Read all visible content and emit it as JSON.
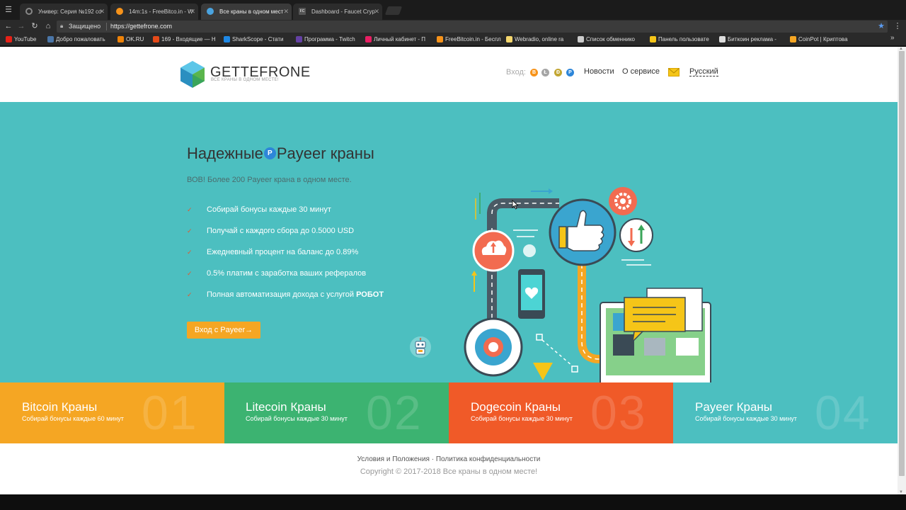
{
  "browser": {
    "tabs": [
      {
        "label": "Универ: Серия №192 со",
        "color": "#888888"
      },
      {
        "label": "14m:1s - FreeBitco.in - W",
        "color": "#f7931a"
      },
      {
        "label": "Все краны в одном мест",
        "color": "#4aa3df"
      },
      {
        "label": "Dashboard - Faucet Cryp",
        "color": "#666666",
        "prefix": "FC"
      }
    ],
    "secure_label": "Защищено",
    "url": "https://gettefrone.com",
    "bookmarks": [
      {
        "label": "YouTube",
        "color": "#e62117"
      },
      {
        "label": "Добро пожаловать",
        "color": "#4a76a8"
      },
      {
        "label": "OK.RU",
        "color": "#ee8208"
      },
      {
        "label": "169 - Входящие — Н",
        "color": "#e64a19"
      },
      {
        "label": "SharkScope - Стати",
        "color": "#1e88e5"
      },
      {
        "label": "Программа - Twitch",
        "color": "#6441a4"
      },
      {
        "label": "Личный кабинет - П",
        "color": "#e91e63"
      },
      {
        "label": "FreeBitcoin.in - Беспл",
        "color": "#f7931a"
      },
      {
        "label": "Webradio, online ra",
        "color": "#f5d76e"
      },
      {
        "label": "Список обменнико",
        "color": "#cccccc"
      },
      {
        "label": "Панель пользовате",
        "color": "#f5c518"
      },
      {
        "label": "Биткоин реклама -",
        "color": "#dddddd"
      },
      {
        "label": "CoinPot | Криптова",
        "color": "#f5a623"
      }
    ]
  },
  "header": {
    "logo_title": "GETTEFRONE",
    "logo_subtitle": "ВСЕ КРАНЫ В ОДНОМ МЕСТЕ!",
    "login_label": "Вход:",
    "coins": [
      {
        "symbol": "B",
        "color": "#f7931a"
      },
      {
        "symbol": "Ł",
        "color": "#a5a5a5"
      },
      {
        "symbol": "Ð",
        "color": "#c2a633"
      },
      {
        "symbol": "P",
        "color": "#2d86d9"
      }
    ],
    "nav": [
      "Новости",
      "О сервисе"
    ],
    "language": "Русский"
  },
  "hero": {
    "title_before": "Надежные",
    "title_badge": "P",
    "title_after": "Payeer краны",
    "subtitle": "ВОВ! Более 200 Payeer крана в одном месте.",
    "features": [
      {
        "text": "Собирай бонусы каждые 30 минут",
        "bold": ""
      },
      {
        "text": "Получай с каждого сбора до 0.5000 USD",
        "bold": ""
      },
      {
        "text": "Ежедневный процент на баланс до 0.89%",
        "bold": ""
      },
      {
        "text": "0.5% платим с заработка ваших рефералов",
        "bold": ""
      },
      {
        "text": "Полная автоматизация дохода с услугой ",
        "bold": "РОБОТ"
      }
    ],
    "cta_label": "Вход с Payeer→"
  },
  "tiles": [
    {
      "title": "Bitcoin Краны",
      "subtitle": "Собирай бонусы каждые 60 минут",
      "number": "01",
      "color": "#f5a623"
    },
    {
      "title": "Litecoin Краны",
      "subtitle": "Собирай бонусы каждые 30 минут",
      "number": "02",
      "color": "#3cb371"
    },
    {
      "title": "Dogecoin Краны",
      "subtitle": "Собирай бонусы каждые 30 минут",
      "number": "03",
      "color": "#f05a28"
    },
    {
      "title": "Payeer Краны",
      "subtitle": "Собирай бонусы каждые 30 минут",
      "number": "04",
      "color": "#4cbfc0"
    }
  ],
  "footer": {
    "links": [
      "Условия и Положения",
      "Политика конфиденциальности"
    ],
    "separator": "·",
    "copyright": "Copyright © 2017-2018 Все краны в одном месте!"
  }
}
